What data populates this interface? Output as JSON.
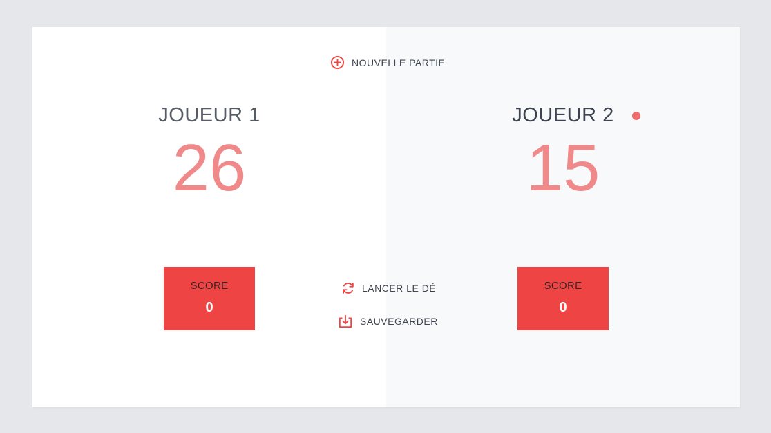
{
  "actions": {
    "new_game": "NOUVELLE PARTIE",
    "roll_dice": "LANCER LE DÉ",
    "save": "SAUVEGARDER"
  },
  "players": [
    {
      "name": "JOUEUR 1",
      "total": "26",
      "score_label": "SCORE",
      "current_score": "0",
      "active": false
    },
    {
      "name": "JOUEUR 2",
      "total": "15",
      "score_label": "SCORE",
      "current_score": "0",
      "active": true
    }
  ],
  "colors": {
    "accent": "#ef4444",
    "total_text": "#f08a8a",
    "active_dot": "#ed6b6b",
    "background": "#e5e7ea"
  },
  "icons": {
    "new_game": "plus-circle-icon",
    "roll_dice": "refresh-icon",
    "save": "download-icon",
    "active": "active-player-dot"
  }
}
